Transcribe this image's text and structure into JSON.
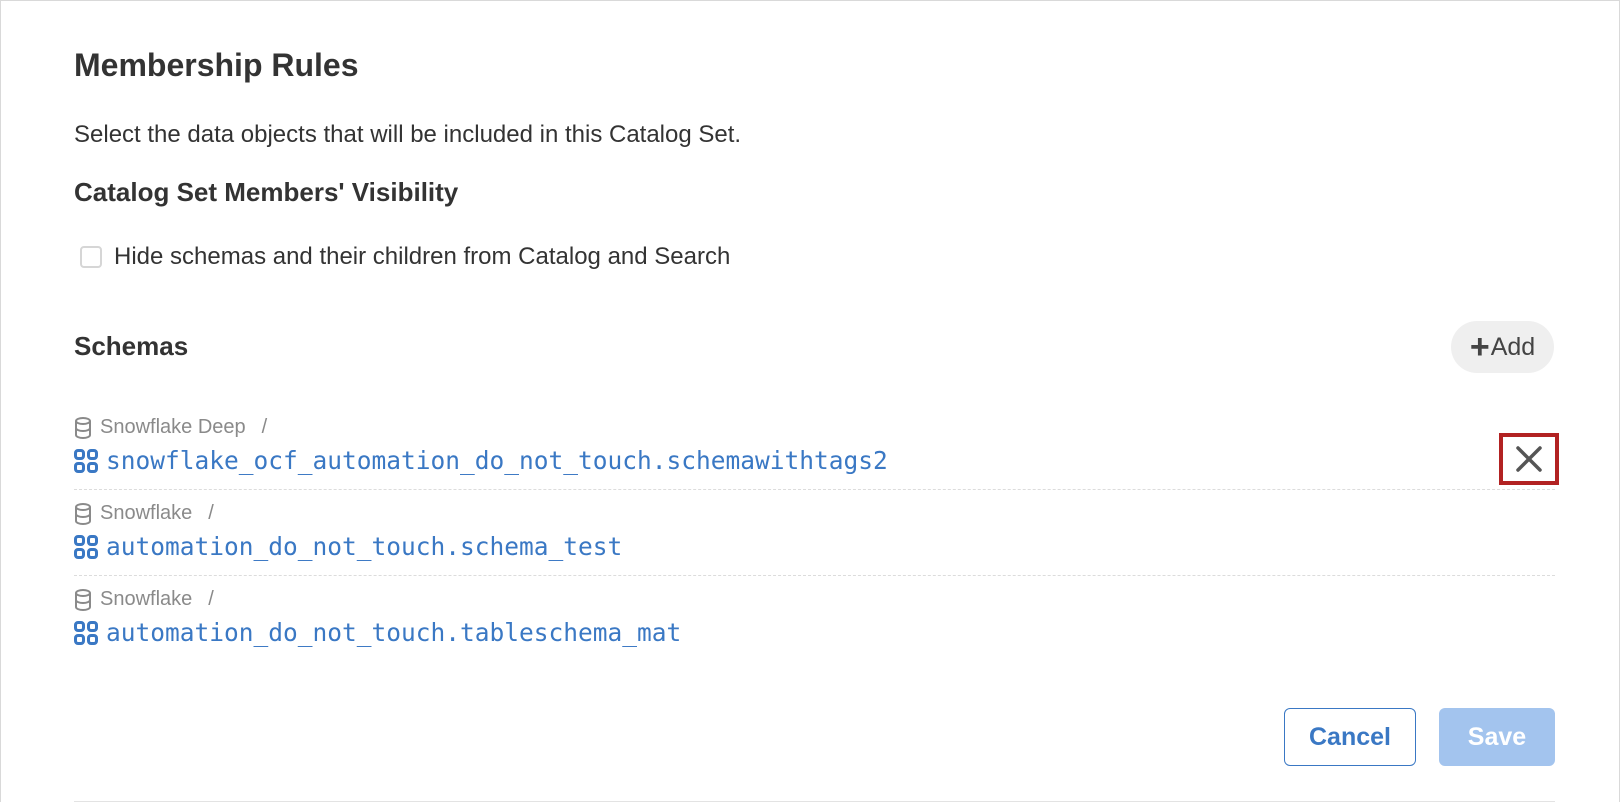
{
  "membership": {
    "title": "Membership Rules",
    "description": "Select the data objects that will be included in this Catalog Set."
  },
  "visibility": {
    "title": "Catalog Set Members' Visibility",
    "checkbox_label": "Hide schemas and their children from Catalog and Search",
    "checked": false
  },
  "schemas": {
    "title": "Schemas",
    "add_label": "Add",
    "items": [
      {
        "source": "Snowflake Deep",
        "separator": "/",
        "name": "snowflake_ocf_automation_do_not_touch.schemawithtags2"
      },
      {
        "source": "Snowflake",
        "separator": "/",
        "name": "automation_do_not_touch.schema_test"
      },
      {
        "source": "Snowflake",
        "separator": "/",
        "name": "automation_do_not_touch.tableschema_mat"
      }
    ]
  },
  "actions": {
    "cancel_label": "Cancel",
    "save_label": "Save"
  },
  "colors": {
    "link": "#3a78c4",
    "save_disabled": "#a3c4ee",
    "highlight": "#b22222"
  },
  "icons": {
    "source": "database-icon",
    "schema": "schema-grid-icon",
    "remove": "close-icon",
    "add": "plus-icon"
  }
}
